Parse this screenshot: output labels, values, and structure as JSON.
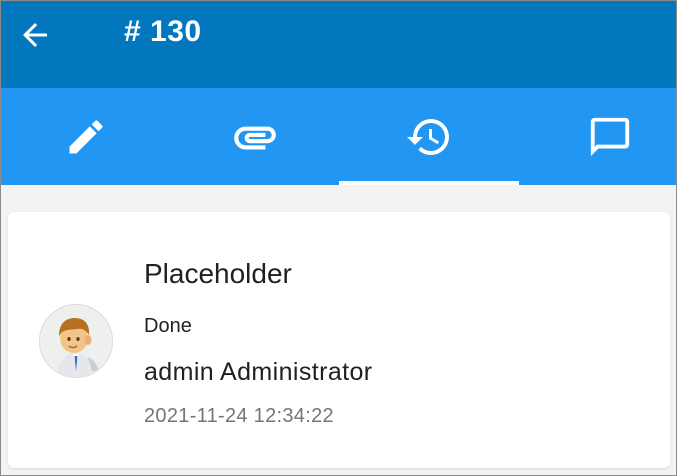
{
  "appbar": {
    "back_icon": "arrow-back-icon",
    "title": "# 130",
    "background": "#0277bd"
  },
  "tabs": [
    {
      "name": "edit",
      "icon": "pencil-icon",
      "selected": false
    },
    {
      "name": "attachments",
      "icon": "paperclip-icon",
      "selected": false
    },
    {
      "name": "history",
      "icon": "history-icon",
      "selected": true
    },
    {
      "name": "comments",
      "icon": "comment-icon",
      "selected": false
    }
  ],
  "tabbar_color": "#2196f3",
  "history_entry": {
    "title": "Placeholder",
    "status": "Done",
    "user": "admin Administrator",
    "timestamp": "2021-11-24 12:34:22",
    "avatar_icon": "user-avatar"
  }
}
